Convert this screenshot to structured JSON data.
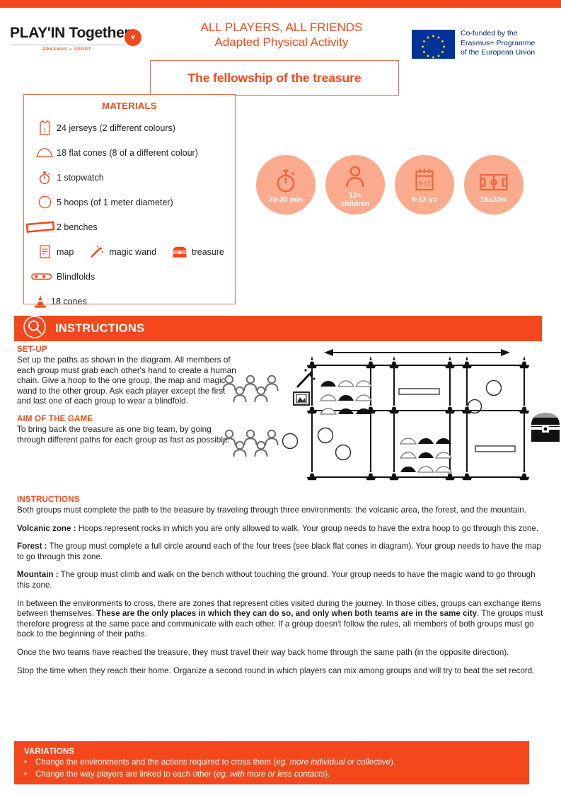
{
  "header": {
    "logo_text": "PLAY'IN Together",
    "logo_subtitle": "ERASMUS + SPORT",
    "program_line1": "ALL PLAYERS, ALL FRIENDS",
    "program_line2": "Adapted Physical Activity",
    "activity_title": "The fellowship of the treasure",
    "eu_line1": "Co-funded by the",
    "eu_line2": "Erasmus+ Programme",
    "eu_line3": "of the European Union"
  },
  "materials": {
    "title": "MATERIALS",
    "items": [
      {
        "icon": "jersey-icon",
        "label": "24 jerseys (2 different colours)"
      },
      {
        "icon": "flat-cone-icon",
        "label": "18 flat cones (8 of a different colour)"
      },
      {
        "icon": "stopwatch-icon",
        "label": "1 stopwatch"
      },
      {
        "icon": "hoop-icon",
        "label": "5 hoops (of 1 meter diameter)"
      },
      {
        "icon": "bench-icon",
        "label": "2 benches"
      },
      {
        "icon": "map-icon",
        "label": "map"
      },
      {
        "icon": "magic-wand-icon",
        "label": "magic wand"
      },
      {
        "icon": "treasure-icon",
        "label": "treasure"
      },
      {
        "icon": "blindfold-icon",
        "label": "Blindfolds"
      },
      {
        "icon": "cone-icon",
        "label": "18 cones"
      }
    ]
  },
  "info": [
    {
      "icon": "stopwatch-icon",
      "label": "20-30 min"
    },
    {
      "icon": "person-icon",
      "label": "12+\nchildren",
      "line1": "12+",
      "line2": "children"
    },
    {
      "icon": "calendar-icon",
      "label": "8-12 yo",
      "badge": "8-12"
    },
    {
      "icon": "field-icon",
      "label": "15x20m"
    }
  ],
  "instructions_banner": {
    "icon": "magnifier-icon",
    "label": "INSTRUCTIONS"
  },
  "setup": {
    "heading": "SET-UP",
    "text": "Set up the paths as shown in the diagram. All members of each group must grab each other's hand to create a human chain. Give a hoop to the one group, the map and magic wand to the other group. Ask each player except the first and last one of each group to wear a blindfold."
  },
  "aim": {
    "heading": "AIM OF THE GAME",
    "text": "To bring back the treasure as one big team, by going through different paths for each group as fast as possible."
  },
  "instructions": {
    "heading": "INSTRUCTIONS",
    "intro": "Both groups must complete the path to the treasure by traveling through three environments: the volcanic area, the forest, and the mountain.",
    "volcanic_label": "Volcanic zone :",
    "volcanic_text": " Hoops represent rocks in which you are only allowed to walk. Your group needs to have the extra hoop to go through this zone.",
    "forest_label": "Forest :",
    "forest_text": " The group must complete a full circle around each of the four trees (see black flat cones in diagram).  Your group needs to have the map to go through this zone.",
    "mountain_label": "Mountain :",
    "mountain_text": " The group must climb and walk on the bench without touching the ground. Your group needs to have the magic wand to go through this zone.",
    "cities_part1": "In between the environments to cross, there are zones that represent cities visited during the journey. In those cities, groups can exchange items between themselves.  ",
    "cities_bold": "These are the only places in which they can do so, and only when both teams are in the same city",
    "cities_part2": ". The groups must therefore progress at the same pace and communicate with each other. If a group doesn't follow the rules, all members of both groups must go back to the beginning of their paths.",
    "return_text": "Once the two teams have reached the treasure, they must travel their way back home through the same path (in the opposite direction).",
    "timing_text": "Stop the time when they reach their home. Organize a second round in which players can mix among groups and will try to beat the set record."
  },
  "variations": {
    "title": "VARIATIONS",
    "items": [
      {
        "bullet": "•",
        "text": "Change the environments and the actions required to cross them (",
        "italic": "eg. more individual or collective",
        "tail": ")."
      },
      {
        "bullet": "•",
        "text": "Change the way players are linked to each other (",
        "italic": "eg. with more or less contacts",
        "tail": ")."
      }
    ]
  },
  "diagram": {
    "name": "field-setup-diagram",
    "arrow": "double-headed-arrow",
    "treasure": "treasure-chest-icon",
    "group_top": "team-group-top",
    "group_bottom": "team-group-bottom",
    "map_icon": "map-icon",
    "wand_icon": "magic-wand-icon"
  },
  "colors": {
    "brand_orange": "#F4481C",
    "light_orange": "#FBAB8D",
    "box_border": "#E2714F",
    "eu_blue": "#003399",
    "text": "#231f20"
  }
}
